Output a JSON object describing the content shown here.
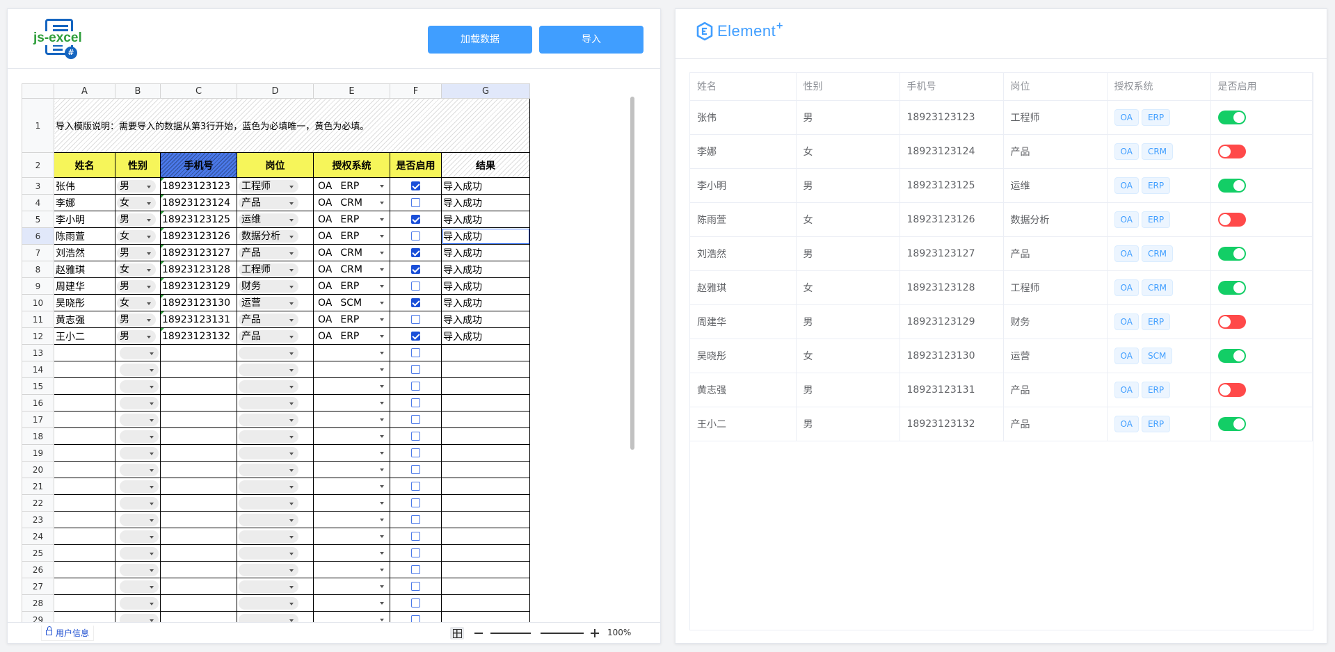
{
  "left": {
    "logo_text": "js-excel",
    "logo_badge": "#",
    "buttons": {
      "load": "加载数据",
      "import": "导入"
    },
    "columns": [
      "A",
      "B",
      "C",
      "D",
      "E",
      "F",
      "G"
    ],
    "instruction": "导入模版说明：需要导入的数据从第3行开始，蓝色为必填唯一，黄色为必填。",
    "headers": [
      "姓名",
      "性别",
      "手机号",
      "岗位",
      "授权系统",
      "是否启用",
      "结果"
    ],
    "rows": [
      {
        "name": "张伟",
        "gender": "男",
        "phone": "18923123123",
        "job": "工程师",
        "systems": [
          "OA",
          "ERP"
        ],
        "enabled": true,
        "result": "导入成功"
      },
      {
        "name": "李娜",
        "gender": "女",
        "phone": "18923123124",
        "job": "产品",
        "systems": [
          "OA",
          "CRM"
        ],
        "enabled": false,
        "result": "导入成功"
      },
      {
        "name": "李小明",
        "gender": "男",
        "phone": "18923123125",
        "job": "运维",
        "systems": [
          "OA",
          "ERP"
        ],
        "enabled": true,
        "result": "导入成功"
      },
      {
        "name": "陈雨萱",
        "gender": "女",
        "phone": "18923123126",
        "job": "数据分析",
        "systems": [
          "OA",
          "ERP"
        ],
        "enabled": false,
        "result": "导入成功"
      },
      {
        "name": "刘浩然",
        "gender": "男",
        "phone": "18923123127",
        "job": "产品",
        "systems": [
          "OA",
          "CRM"
        ],
        "enabled": true,
        "result": "导入成功"
      },
      {
        "name": "赵雅琪",
        "gender": "女",
        "phone": "18923123128",
        "job": "工程师",
        "systems": [
          "OA",
          "CRM"
        ],
        "enabled": true,
        "result": "导入成功"
      },
      {
        "name": "周建华",
        "gender": "男",
        "phone": "18923123129",
        "job": "财务",
        "systems": [
          "OA",
          "ERP"
        ],
        "enabled": false,
        "result": "导入成功"
      },
      {
        "name": "吴晓彤",
        "gender": "女",
        "phone": "18923123130",
        "job": "运营",
        "systems": [
          "OA",
          "SCM"
        ],
        "enabled": true,
        "result": "导入成功"
      },
      {
        "name": "黄志强",
        "gender": "男",
        "phone": "18923123131",
        "job": "产品",
        "systems": [
          "OA",
          "ERP"
        ],
        "enabled": false,
        "result": "导入成功"
      },
      {
        "name": "王小二",
        "gender": "男",
        "phone": "18923123132",
        "job": "产品",
        "systems": [
          "OA",
          "ERP"
        ],
        "enabled": true,
        "result": "导入成功"
      }
    ],
    "empty_row_numbers": [
      "13",
      "14",
      "15",
      "16",
      "17",
      "18",
      "19",
      "20",
      "21",
      "22",
      "23",
      "24",
      "25",
      "26",
      "27",
      "28",
      "29"
    ],
    "sheet_tab": "用户信息",
    "zoom": "100%"
  },
  "right": {
    "brand": "Element",
    "brand_sup": "+",
    "headers": [
      "姓名",
      "性别",
      "手机号",
      "岗位",
      "授权系统",
      "是否启用"
    ],
    "colors": {
      "primary": "#409eff",
      "switch_on": "#13ce66",
      "switch_off": "#ff4949"
    }
  }
}
